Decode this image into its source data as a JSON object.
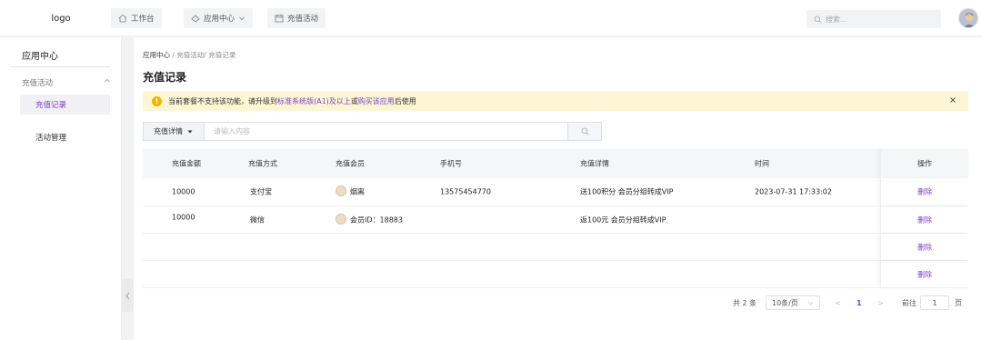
{
  "header": {
    "logo": "logo",
    "nav": [
      {
        "label": "工作台",
        "icon": "home-icon"
      },
      {
        "label": "应用中心",
        "icon": "app-center-icon"
      },
      {
        "label": "充值活动",
        "icon": "calendar-icon"
      }
    ],
    "search_placeholder": "搜索..."
  },
  "sidebar": {
    "title": "应用中心",
    "group": "充值活动",
    "items": [
      {
        "label": "充值记录",
        "active": true
      },
      {
        "label": "活动管理",
        "active": false
      }
    ]
  },
  "main": {
    "breadcrumb": {
      "first": "应用中心",
      "rest": " / 充值活动/ 充值记录"
    },
    "title": "充值记录",
    "alert": {
      "text_before": "当前套餐不支持该功能，请升级到 ",
      "link1": "标准系统版(A1)及以上",
      "text_mid": " 或 ",
      "link2": "购买该应用",
      "text_after": " 后使用"
    },
    "filter": {
      "select_label": "充值详情",
      "placeholder": "请输入内容"
    },
    "table": {
      "columns": [
        "充值金额",
        "充值方式",
        "充值会员",
        "手机号",
        "充值详情",
        "时间",
        "操作"
      ],
      "rows": [
        {
          "amount": "10000",
          "method": "支付宝",
          "member": "烟离",
          "phone": "13575454770",
          "detail": "送100积分 会员分组转成VIP",
          "time": "2023-07-31 17:33:02",
          "action": "删除"
        },
        {
          "amount": "10000",
          "method": "微信",
          "member": "会员ID：18883",
          "phone": "",
          "detail": "返100元 会员分组转成VIP",
          "time": "",
          "action": "删除"
        },
        {
          "amount": "",
          "method": "",
          "member": "",
          "phone": "",
          "detail": "",
          "time": "",
          "action": "删除"
        },
        {
          "amount": "",
          "method": "",
          "member": "",
          "phone": "",
          "detail": "",
          "time": "",
          "action": "删除"
        }
      ]
    },
    "pagination": {
      "total": "共 2 条",
      "page_size": "10条/页",
      "prev": "<",
      "current": "1",
      "next": ">",
      "jump_label": "前往",
      "jump_value": "1",
      "jump_suffix": "页"
    }
  },
  "colors": {
    "accent": "#7b3fc4",
    "alert_bg": "#fdf6d5",
    "alert_icon": "#f2b400"
  }
}
